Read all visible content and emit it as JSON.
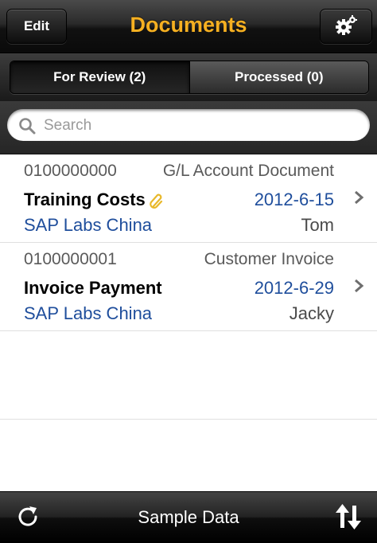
{
  "navbar": {
    "edit_label": "Edit",
    "title": "Documents",
    "settings_icon": "gear-icon",
    "title_color": "#f6b021"
  },
  "segments": [
    {
      "label": "For Review (2)",
      "active": true
    },
    {
      "label": "Processed (0)",
      "active": false
    }
  ],
  "search": {
    "placeholder": "Search",
    "value": ""
  },
  "documents": [
    {
      "number": "0100000000",
      "type": "G/L Account Document",
      "title": "Training Costs",
      "has_attachment": true,
      "date": "2012-6-15",
      "company": "SAP Labs China",
      "person": "Tom"
    },
    {
      "number": "0100000001",
      "type": "Customer Invoice",
      "title": "Invoice Payment",
      "has_attachment": false,
      "date": "2012-6-29",
      "company": "SAP Labs China",
      "person": "Jacky"
    }
  ],
  "toolbar": {
    "title": "Sample Data",
    "refresh_icon": "refresh-icon",
    "sort_icon": "sort-icon"
  },
  "colors": {
    "link_blue": "#1f4e9c",
    "attachment_gold": "#e8b82a"
  }
}
